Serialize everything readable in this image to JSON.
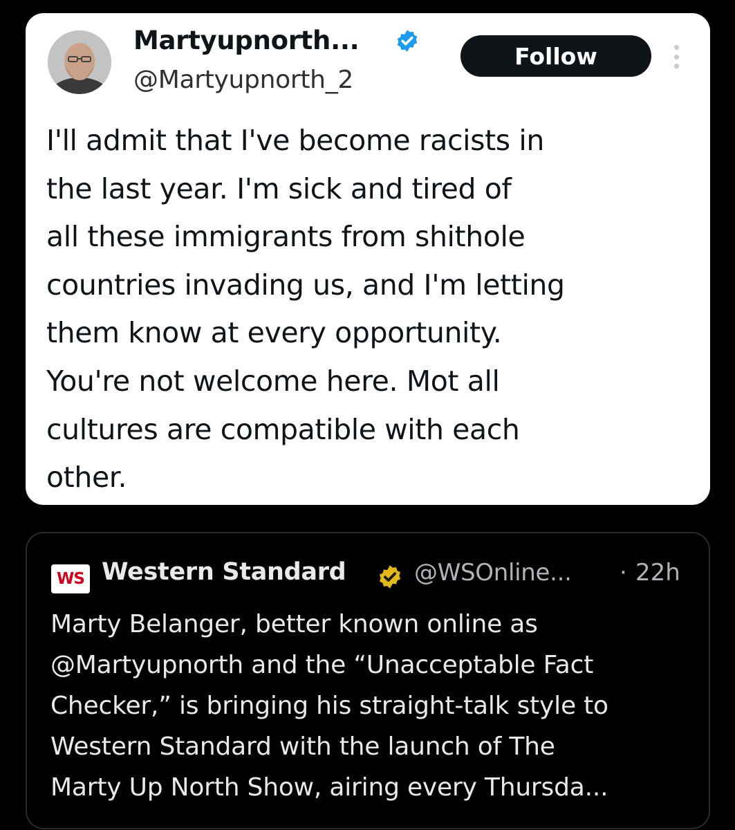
{
  "tweet": {
    "display_name": "Martyupnorth...",
    "handle": "@Martyupnorth_2",
    "follow_label": "Follow",
    "text": "I'll admit that I've become racists in\nthe last year.  I'm sick and tired of\nall these immigrants from shithole\ncountries invading us, and I'm letting\nthem know at every opportunity.\nYou're not welcome here.  Mot all\ncultures are compatible with each\nother."
  },
  "quoted": {
    "logo_text": "WS",
    "name": "Western Standard",
    "handle": "@WSOnline...",
    "separator": "·",
    "time": "22h",
    "text": "Marty Belanger, better known online as\n@Martyupnorth and the “Unacceptable Fact\nChecker,” is bringing his straight-talk style to\nWestern Standard with the launch of The\nMarty Up North Show, airing every Thursda..."
  },
  "colors": {
    "verified_blue": "#1d9bf0",
    "verified_gold": "#e2b719",
    "brand_red": "#d0021b"
  },
  "icons": [
    "avatar",
    "verified-badge-icon",
    "more-options-icon",
    "ws-logo",
    "verified-gold-icon"
  ]
}
